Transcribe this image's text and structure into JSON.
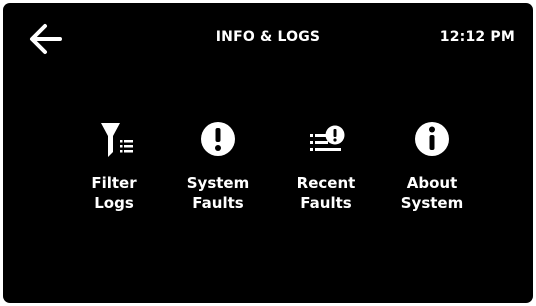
{
  "header": {
    "back_icon": "arrow-left-icon",
    "title": "INFO & LOGS",
    "time": "12:12 PM"
  },
  "menu": {
    "items": [
      {
        "label": "Filter Logs",
        "icon": "filter-list-icon"
      },
      {
        "label": "System Faults",
        "icon": "exclamation-circle-icon"
      },
      {
        "label": "Recent Faults",
        "icon": "list-exclamation-icon"
      },
      {
        "label": "About System",
        "icon": "info-circle-icon"
      }
    ]
  },
  "colors": {
    "background": "#000000",
    "foreground": "#ffffff"
  }
}
